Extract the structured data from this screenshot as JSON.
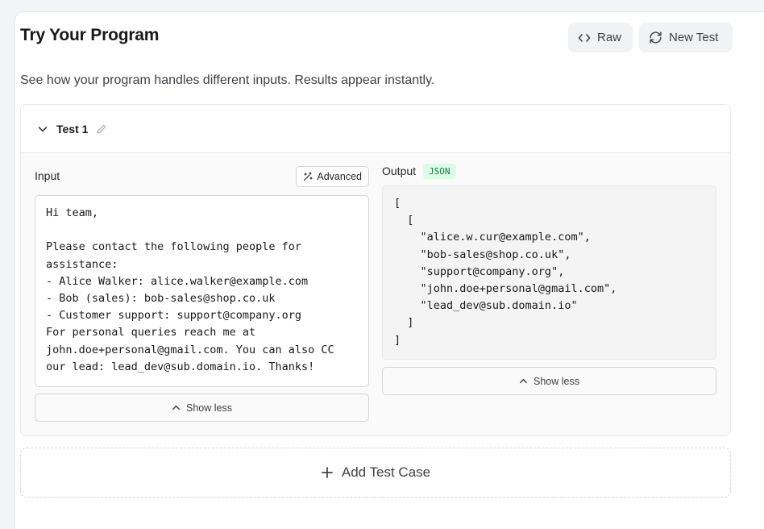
{
  "header": {
    "title": "Try Your Program",
    "raw_label": "Raw",
    "new_test_label": "New Test"
  },
  "subtitle": "See how your program handles different inputs. Results appear instantly.",
  "test": {
    "name": "Test 1",
    "input_label": "Input",
    "advanced_label": "Advanced",
    "output_label": "Output",
    "output_format": "JSON",
    "input_text": "Hi team,\n\nPlease contact the following people for\nassistance:\n- Alice Walker: alice.walker@example.com\n- Bob (sales): bob-sales@shop.co.uk\n- Customer support: support@company.org\nFor personal queries reach me at\njohn.doe+personal@gmail.com. You can also CC\nour lead: lead_dev@sub.domain.io. Thanks!",
    "output_text": "[\n  [\n    \"alice.w.cur@example.com\",\n    \"bob-sales@shop.co.uk\",\n    \"support@company.org\",\n    \"john.doe+personal@gmail.com\",\n    \"lead_dev@sub.domain.io\"\n  ]\n]",
    "show_less_label": "Show less"
  },
  "add_case_label": "Add Test Case",
  "icons": {
    "raw": "code-brackets-icon",
    "new_test": "refresh-icon",
    "collapse": "chevron-down-icon",
    "edit": "pencil-icon",
    "advanced": "magic-wand-icon",
    "show_less": "chevron-up-icon",
    "add": "plus-icon"
  },
  "colors": {
    "json_badge_text": "#15803d",
    "json_badge_bg": "#dcfce7"
  }
}
